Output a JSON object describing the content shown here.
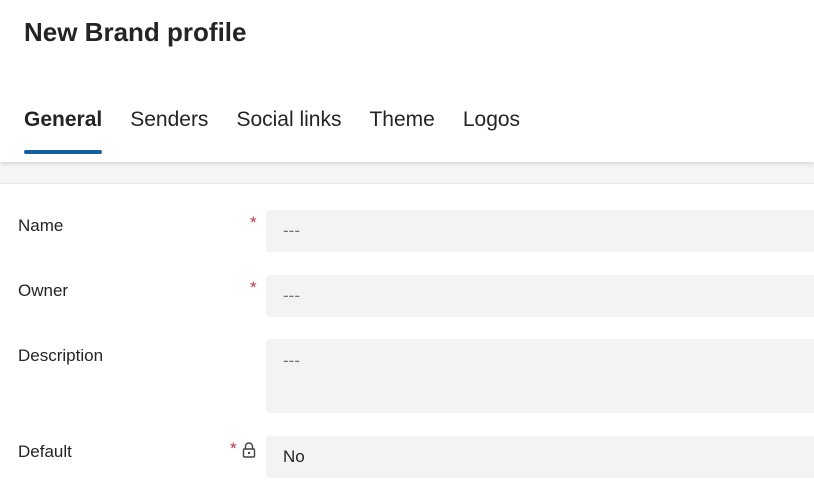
{
  "header": {
    "title": "New Brand profile"
  },
  "tabs": [
    {
      "label": "General",
      "active": true
    },
    {
      "label": "Senders",
      "active": false
    },
    {
      "label": "Social links",
      "active": false
    },
    {
      "label": "Theme",
      "active": false
    },
    {
      "label": "Logos",
      "active": false
    }
  ],
  "form": {
    "required_mark": "*",
    "fields": [
      {
        "label": "Name",
        "required": true,
        "placeholder": "---",
        "value": ""
      },
      {
        "label": "Owner",
        "required": true,
        "placeholder": "---",
        "value": ""
      },
      {
        "label": "Description",
        "required": false,
        "placeholder": "---",
        "value": ""
      },
      {
        "label": "Default",
        "required": true,
        "locked": true,
        "value": "No"
      }
    ]
  },
  "colors": {
    "accent": "#115ea3",
    "required": "#c4314b",
    "field_background": "#f3f3f3"
  },
  "icons": {
    "lock": "lock-icon"
  }
}
